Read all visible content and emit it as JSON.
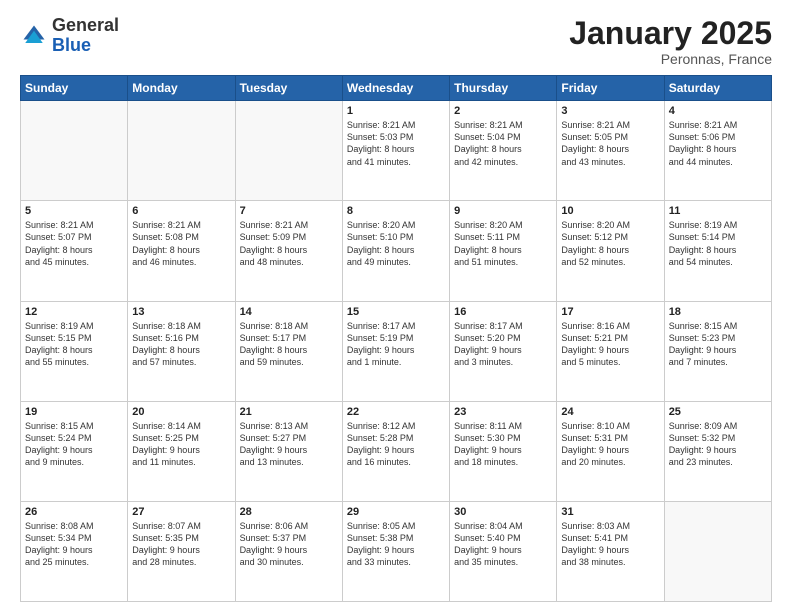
{
  "logo": {
    "general": "General",
    "blue": "Blue"
  },
  "header": {
    "month": "January 2025",
    "location": "Peronnas, France"
  },
  "days_of_week": [
    "Sunday",
    "Monday",
    "Tuesday",
    "Wednesday",
    "Thursday",
    "Friday",
    "Saturday"
  ],
  "weeks": [
    [
      {
        "day": "",
        "info": ""
      },
      {
        "day": "",
        "info": ""
      },
      {
        "day": "",
        "info": ""
      },
      {
        "day": "1",
        "info": "Sunrise: 8:21 AM\nSunset: 5:03 PM\nDaylight: 8 hours\nand 41 minutes."
      },
      {
        "day": "2",
        "info": "Sunrise: 8:21 AM\nSunset: 5:04 PM\nDaylight: 8 hours\nand 42 minutes."
      },
      {
        "day": "3",
        "info": "Sunrise: 8:21 AM\nSunset: 5:05 PM\nDaylight: 8 hours\nand 43 minutes."
      },
      {
        "day": "4",
        "info": "Sunrise: 8:21 AM\nSunset: 5:06 PM\nDaylight: 8 hours\nand 44 minutes."
      }
    ],
    [
      {
        "day": "5",
        "info": "Sunrise: 8:21 AM\nSunset: 5:07 PM\nDaylight: 8 hours\nand 45 minutes."
      },
      {
        "day": "6",
        "info": "Sunrise: 8:21 AM\nSunset: 5:08 PM\nDaylight: 8 hours\nand 46 minutes."
      },
      {
        "day": "7",
        "info": "Sunrise: 8:21 AM\nSunset: 5:09 PM\nDaylight: 8 hours\nand 48 minutes."
      },
      {
        "day": "8",
        "info": "Sunrise: 8:20 AM\nSunset: 5:10 PM\nDaylight: 8 hours\nand 49 minutes."
      },
      {
        "day": "9",
        "info": "Sunrise: 8:20 AM\nSunset: 5:11 PM\nDaylight: 8 hours\nand 51 minutes."
      },
      {
        "day": "10",
        "info": "Sunrise: 8:20 AM\nSunset: 5:12 PM\nDaylight: 8 hours\nand 52 minutes."
      },
      {
        "day": "11",
        "info": "Sunrise: 8:19 AM\nSunset: 5:14 PM\nDaylight: 8 hours\nand 54 minutes."
      }
    ],
    [
      {
        "day": "12",
        "info": "Sunrise: 8:19 AM\nSunset: 5:15 PM\nDaylight: 8 hours\nand 55 minutes."
      },
      {
        "day": "13",
        "info": "Sunrise: 8:18 AM\nSunset: 5:16 PM\nDaylight: 8 hours\nand 57 minutes."
      },
      {
        "day": "14",
        "info": "Sunrise: 8:18 AM\nSunset: 5:17 PM\nDaylight: 8 hours\nand 59 minutes."
      },
      {
        "day": "15",
        "info": "Sunrise: 8:17 AM\nSunset: 5:19 PM\nDaylight: 9 hours\nand 1 minute."
      },
      {
        "day": "16",
        "info": "Sunrise: 8:17 AM\nSunset: 5:20 PM\nDaylight: 9 hours\nand 3 minutes."
      },
      {
        "day": "17",
        "info": "Sunrise: 8:16 AM\nSunset: 5:21 PM\nDaylight: 9 hours\nand 5 minutes."
      },
      {
        "day": "18",
        "info": "Sunrise: 8:15 AM\nSunset: 5:23 PM\nDaylight: 9 hours\nand 7 minutes."
      }
    ],
    [
      {
        "day": "19",
        "info": "Sunrise: 8:15 AM\nSunset: 5:24 PM\nDaylight: 9 hours\nand 9 minutes."
      },
      {
        "day": "20",
        "info": "Sunrise: 8:14 AM\nSunset: 5:25 PM\nDaylight: 9 hours\nand 11 minutes."
      },
      {
        "day": "21",
        "info": "Sunrise: 8:13 AM\nSunset: 5:27 PM\nDaylight: 9 hours\nand 13 minutes."
      },
      {
        "day": "22",
        "info": "Sunrise: 8:12 AM\nSunset: 5:28 PM\nDaylight: 9 hours\nand 16 minutes."
      },
      {
        "day": "23",
        "info": "Sunrise: 8:11 AM\nSunset: 5:30 PM\nDaylight: 9 hours\nand 18 minutes."
      },
      {
        "day": "24",
        "info": "Sunrise: 8:10 AM\nSunset: 5:31 PM\nDaylight: 9 hours\nand 20 minutes."
      },
      {
        "day": "25",
        "info": "Sunrise: 8:09 AM\nSunset: 5:32 PM\nDaylight: 9 hours\nand 23 minutes."
      }
    ],
    [
      {
        "day": "26",
        "info": "Sunrise: 8:08 AM\nSunset: 5:34 PM\nDaylight: 9 hours\nand 25 minutes."
      },
      {
        "day": "27",
        "info": "Sunrise: 8:07 AM\nSunset: 5:35 PM\nDaylight: 9 hours\nand 28 minutes."
      },
      {
        "day": "28",
        "info": "Sunrise: 8:06 AM\nSunset: 5:37 PM\nDaylight: 9 hours\nand 30 minutes."
      },
      {
        "day": "29",
        "info": "Sunrise: 8:05 AM\nSunset: 5:38 PM\nDaylight: 9 hours\nand 33 minutes."
      },
      {
        "day": "30",
        "info": "Sunrise: 8:04 AM\nSunset: 5:40 PM\nDaylight: 9 hours\nand 35 minutes."
      },
      {
        "day": "31",
        "info": "Sunrise: 8:03 AM\nSunset: 5:41 PM\nDaylight: 9 hours\nand 38 minutes."
      },
      {
        "day": "",
        "info": ""
      }
    ]
  ]
}
